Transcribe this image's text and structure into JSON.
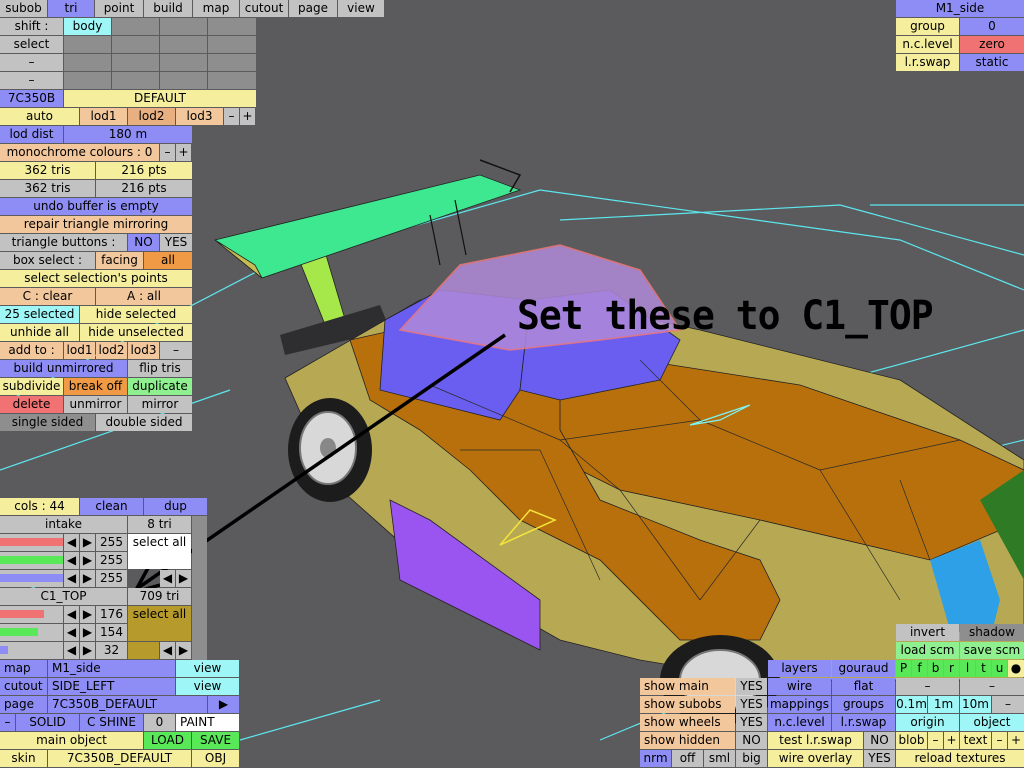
{
  "menu": {
    "subob": "subob",
    "tri": "tri",
    "point": "point",
    "build": "build",
    "map": "map",
    "cutout": "cutout",
    "page": "page",
    "view": "view"
  },
  "left": {
    "shift": "shift :",
    "body": "body",
    "select": "select",
    "dash": "–",
    "code": "7C350B",
    "default": "DEFAULT",
    "auto": "auto",
    "lod1": "lod1",
    "lod2": "lod2",
    "lod3": "lod3",
    "minus": "–",
    "plus": "+",
    "lod_dist": "lod dist",
    "lod_dist_val": "180 m",
    "monochrome": "monochrome colours : 0",
    "tris1": "362 tris",
    "pts1": "216 pts",
    "tris2": "362 tris",
    "pts2": "216 pts",
    "undo": "undo buffer is empty",
    "repair": "repair triangle mirroring",
    "tri_buttons": "triangle buttons :",
    "no": "NO",
    "yes": "YES",
    "box_select": "box select :",
    "facing": "facing",
    "all": "all",
    "select_sel_points": "select selection's points",
    "c_clear": "C : clear",
    "a_all": "A : all",
    "selected25": "25 selected",
    "hide_selected": "hide selected",
    "unhide_all": "unhide all",
    "hide_unselected": "hide unselected",
    "add_to": "add to :",
    "build_unmirrored": "build unmirrored",
    "flip_tris": "flip tris",
    "subdivide": "subdivide",
    "break_off": "break off",
    "duplicate": "duplicate",
    "delete": "delete",
    "unmirror": "unmirror",
    "mirror": "mirror",
    "single_sided": "single sided",
    "double_sided": "double sided"
  },
  "cols": {
    "label": "cols : 44",
    "clean": "clean",
    "dup": "dup",
    "intake": "intake",
    "tri8": "8 tri",
    "v255a": "255",
    "v255b": "255",
    "v255c": "255",
    "select_all": "select all",
    "c1top": "C1_TOP",
    "tri709": "709 tri",
    "v176": "176",
    "v154": "154",
    "v32": "32",
    "select_all2": "select all"
  },
  "bottom_left": {
    "map": "map",
    "map_val": "M1_side",
    "view": "view",
    "cutout": "cutout",
    "cutout_val": "SIDE_LEFT",
    "view2": "view",
    "page": "page",
    "page_val": "7C350B_DEFAULT",
    "play": "▶",
    "dash": "–",
    "solid": "SOLID",
    "cshine": "C SHINE",
    "zero": "0",
    "paint": "PAINT",
    "main_object": "main object",
    "load": "LOAD",
    "save": "SAVE",
    "skin": "skin",
    "skin_val": "7C350B_DEFAULT",
    "obj": "OBJ"
  },
  "top_right": {
    "m1side": "M1_side",
    "group": "group",
    "group_val": "0",
    "nclevel": "n.c.level",
    "zero": "zero",
    "lrswap": "l.r.swap",
    "static": "static"
  },
  "bottom_right": {
    "show_main": "show main",
    "yes1": "YES",
    "show_subobs": "show subobs",
    "yes2": "YES",
    "show_wheels": "show wheels",
    "yes3": "YES",
    "show_hidden": "show hidden",
    "no1": "NO",
    "nrm": "nrm",
    "off": "off",
    "sml": "sml",
    "big": "big",
    "layers": "layers",
    "gouraud": "gouraud",
    "wire": "wire",
    "flat": "flat",
    "mappings": "mappings",
    "groups": "groups",
    "nclevel": "n.c.level",
    "lrswap": "l.r.swap",
    "test_lrswap": "test l.r.swap",
    "no2": "NO",
    "wire_overlay": "wire overlay",
    "yes4": "YES",
    "invert": "invert",
    "shadow": "shadow",
    "load_scm": "load scm",
    "save_scm": "save scm",
    "letters": [
      "P",
      "f",
      "b",
      "r",
      "l",
      "t",
      "u",
      "●"
    ],
    "dash": "–",
    "dash2": "–",
    "m01": "0.1m",
    "m1": "1m",
    "m10": "10m",
    "dash3": "–",
    "origin": "origin",
    "object": "object",
    "blob": "blob",
    "minus": "–",
    "plus": "+",
    "text": "text",
    "minus2": "–",
    "plus2": "+",
    "reload_textures": "reload textures"
  },
  "annotation": "Set these to C1_TOP",
  "colors": {
    "viewport": "#5b5b5d",
    "body": "#b5722f",
    "roof": "#6f6fe6",
    "wire": "#7cf6f6"
  }
}
